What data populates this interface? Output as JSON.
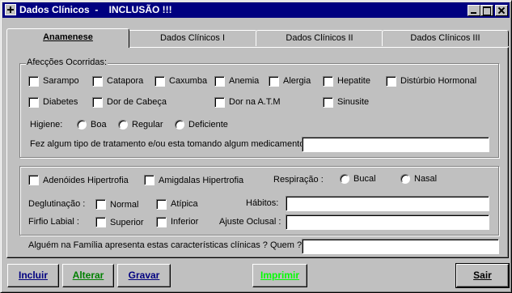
{
  "window": {
    "title": "Dados Clínicos  -    INCLUSÃO !!!",
    "icon": "system-menu-icon",
    "controls": [
      "minimize",
      "maximize",
      "close"
    ]
  },
  "tabs": [
    {
      "label": "Anamenese",
      "active": true
    },
    {
      "label": "Dados Clínicos I",
      "active": false
    },
    {
      "label": "Dados Clínicos II",
      "active": false
    },
    {
      "label": "Dados Clínicos III",
      "active": false
    }
  ],
  "afeccoes": {
    "legend": "Afecções Ocorridas:",
    "checkboxes": [
      {
        "label": "Sarampo",
        "checked": false
      },
      {
        "label": "Catapora",
        "checked": false
      },
      {
        "label": "Caxumba",
        "checked": false
      },
      {
        "label": "Anemia",
        "checked": false
      },
      {
        "label": "Alergia",
        "checked": false
      },
      {
        "label": "Hepatite",
        "checked": false
      },
      {
        "label": "Distúrbio Hormonal",
        "checked": false
      },
      {
        "label": "Diabetes",
        "checked": false
      },
      {
        "label": "Dor de Cabeça",
        "checked": false
      },
      {
        "label": "Dor na A.T.M",
        "checked": false
      },
      {
        "label": "Sinusite",
        "checked": false
      }
    ],
    "higiene_label": "Higiene:",
    "higiene_options": [
      "Boa",
      "Regular",
      "Deficiente"
    ],
    "tratamento_label": "Fez algum tipo de tratamento e/ou esta tomando algum medicamento:",
    "tratamento_value": ""
  },
  "section2": {
    "adenoides_label": "Adenóides Hipertrofia",
    "amigdalas_label": "Amigdalas Hipertrofia",
    "respiracao_label": "Respiração :",
    "respiracao_options": [
      "Bucal",
      "Nasal"
    ],
    "degluticao_label": "Deglutinação :",
    "degluticao_options": [
      "Normal",
      "Atípica"
    ],
    "habitos_label": "Hábitos:",
    "habitos_value": "",
    "freio_label": "Firfio Labial :",
    "freio_options": [
      "Superior",
      "Inferior"
    ],
    "ajuste_label": "Ajuste Oclusal :",
    "ajuste_value": ""
  },
  "familia": {
    "label": "Alguém na Família apresenta estas características clínicas ?  Quem ?",
    "value": ""
  },
  "buttons": {
    "incluir": "Incluir",
    "alterar": "Alterar",
    "gravar": "Gravar",
    "imprimir": "Imprimir",
    "sair": "Sair"
  },
  "colors": {
    "titlebar": "#000080",
    "face": "#c0c0c0",
    "incluir_text": "#000080",
    "alterar_text": "#008000",
    "gravar_text": "#000080",
    "imprimir_text": "#00ff00"
  }
}
